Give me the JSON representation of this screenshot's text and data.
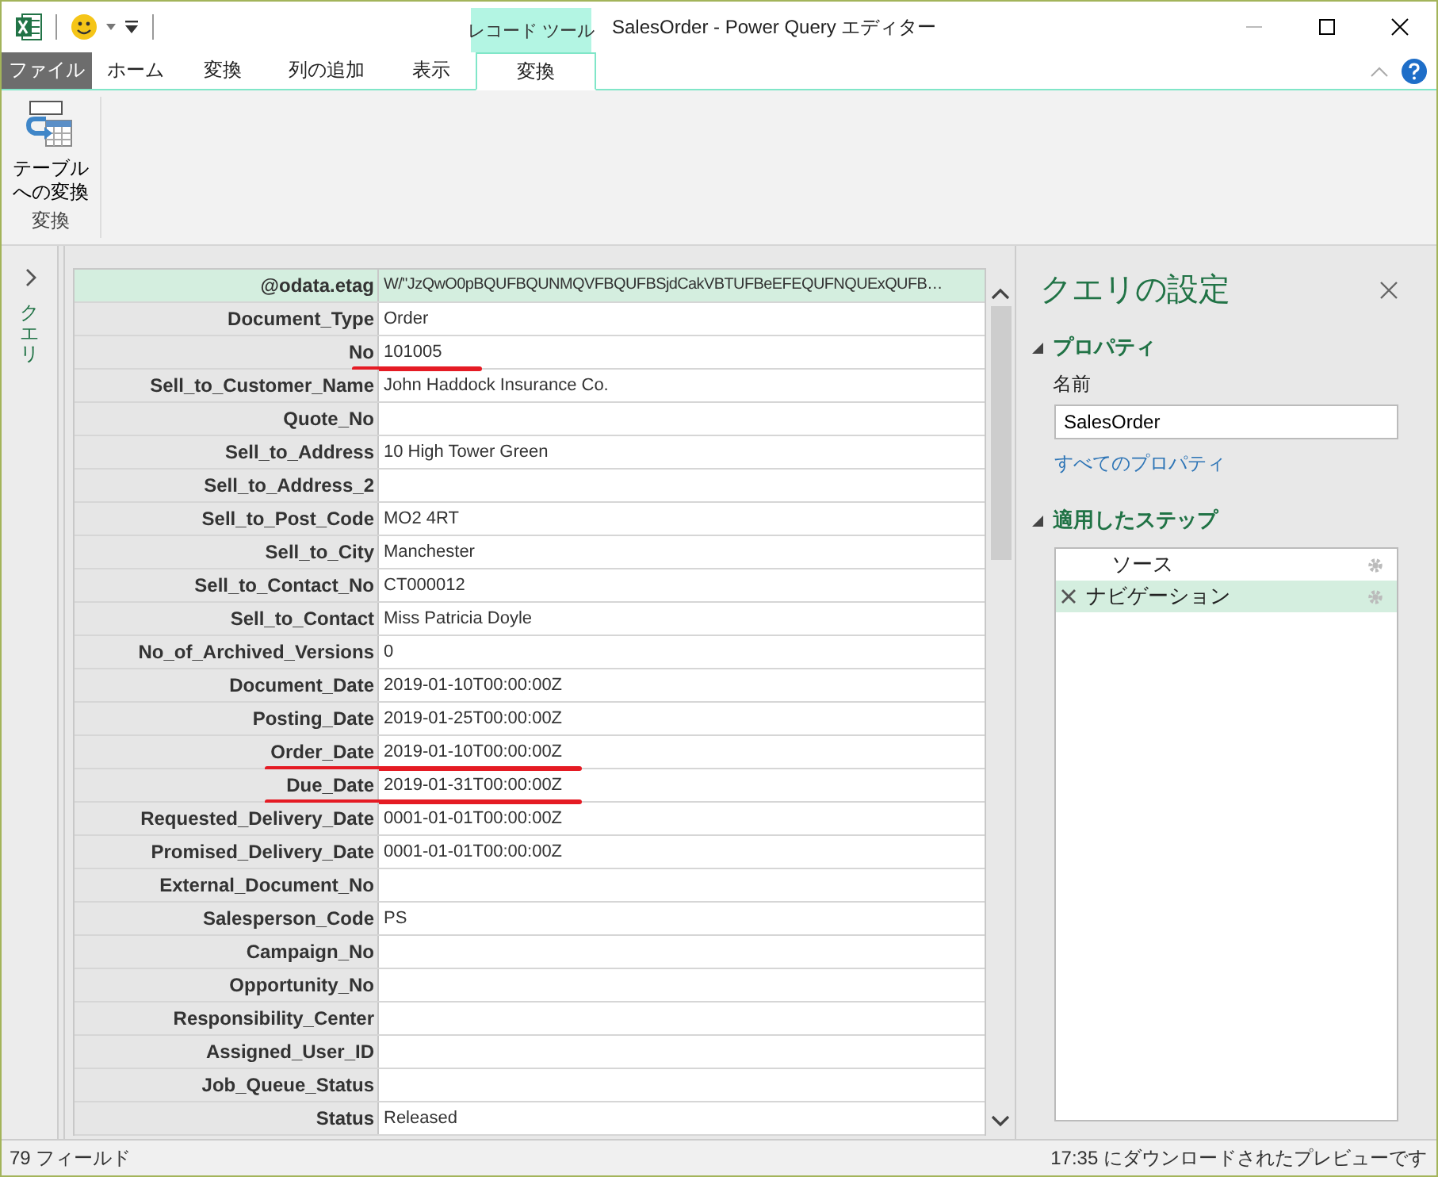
{
  "window": {
    "title": "SalesOrder - Power Query エディター",
    "contextual_group": "レコード ツール"
  },
  "ribbon": {
    "tabs": [
      {
        "label": "ファイル",
        "kind": "file",
        "selected": false
      },
      {
        "label": "ホーム",
        "kind": "normal",
        "selected": false
      },
      {
        "label": "変換",
        "kind": "normal",
        "selected": false
      },
      {
        "label": "列の追加",
        "kind": "normal",
        "selected": false
      },
      {
        "label": "表示",
        "kind": "normal",
        "selected": false
      },
      {
        "label": "変換",
        "kind": "contextual",
        "selected": true
      }
    ],
    "groups": [
      {
        "label": "変換",
        "buttons": [
          {
            "label": "テーブルへの変換"
          }
        ]
      }
    ]
  },
  "queries_pane": {
    "label": "クエリ"
  },
  "record": {
    "rows": [
      {
        "field": "@odata.etag",
        "value": "W/\"JzQwO0pBQUFBQUNMQVFBQUFBSjdCakVBTUFBeEFEQUFNQUExQUFB…",
        "selected": true,
        "underlined": false
      },
      {
        "field": "Document_Type",
        "value": "Order",
        "selected": false,
        "underlined": false
      },
      {
        "field": "No",
        "value": "101005",
        "selected": false,
        "underlined": true
      },
      {
        "field": "Sell_to_Customer_Name",
        "value": "John Haddock Insurance Co.",
        "selected": false,
        "underlined": false
      },
      {
        "field": "Quote_No",
        "selected": false,
        "underlined": false
      },
      {
        "field": "Sell_to_Address",
        "value": "10 High Tower Green",
        "selected": false,
        "underlined": false
      },
      {
        "field": "Sell_to_Address_2",
        "selected": false,
        "underlined": false
      },
      {
        "field": "Sell_to_Post_Code",
        "value": "MO2 4RT",
        "selected": false,
        "underlined": false
      },
      {
        "field": "Sell_to_City",
        "value": "Manchester",
        "selected": false,
        "underlined": false
      },
      {
        "field": "Sell_to_Contact_No",
        "value": "CT000012",
        "selected": false,
        "underlined": false
      },
      {
        "field": "Sell_to_Contact",
        "value": "Miss Patricia Doyle",
        "selected": false,
        "underlined": false
      },
      {
        "field": "No_of_Archived_Versions",
        "value": "0",
        "selected": false,
        "underlined": false
      },
      {
        "field": "Document_Date",
        "value": "2019-01-10T00:00:00Z",
        "selected": false,
        "underlined": false
      },
      {
        "field": "Posting_Date",
        "value": "2019-01-25T00:00:00Z",
        "selected": false,
        "underlined": false
      },
      {
        "field": "Order_Date",
        "value": "2019-01-10T00:00:00Z",
        "selected": false,
        "underlined": true
      },
      {
        "field": "Due_Date",
        "value": "2019-01-31T00:00:00Z",
        "selected": false,
        "underlined": true
      },
      {
        "field": "Requested_Delivery_Date",
        "value": "0001-01-01T00:00:00Z",
        "selected": false,
        "underlined": false
      },
      {
        "field": "Promised_Delivery_Date",
        "value": "0001-01-01T00:00:00Z",
        "selected": false,
        "underlined": false
      },
      {
        "field": "External_Document_No",
        "selected": false,
        "underlined": false
      },
      {
        "field": "Salesperson_Code",
        "value": "PS",
        "selected": false,
        "underlined": false
      },
      {
        "field": "Campaign_No",
        "selected": false,
        "underlined": false
      },
      {
        "field": "Opportunity_No",
        "selected": false,
        "underlined": false
      },
      {
        "field": "Responsibility_Center",
        "selected": false,
        "underlined": false
      },
      {
        "field": "Assigned_User_ID",
        "selected": false,
        "underlined": false
      },
      {
        "field": "Job_Queue_Status",
        "selected": false,
        "underlined": false
      },
      {
        "field": "Status",
        "value": "Released",
        "selected": false,
        "underlined": false
      }
    ]
  },
  "settings": {
    "title": "クエリの設定",
    "properties_heading": "プロパティ",
    "name_label": "名前",
    "name_value": "SalesOrder",
    "all_properties_link": "すべてのプロパティ",
    "steps_heading": "適用したステップ",
    "steps": [
      {
        "label": "ソース",
        "selected": false,
        "deletable": false
      },
      {
        "label": "ナビゲーション",
        "selected": true,
        "deletable": true
      }
    ]
  },
  "status_bar": {
    "left": "79 フィールド",
    "right": "17:35 にダウンロードされたプレビューです"
  }
}
